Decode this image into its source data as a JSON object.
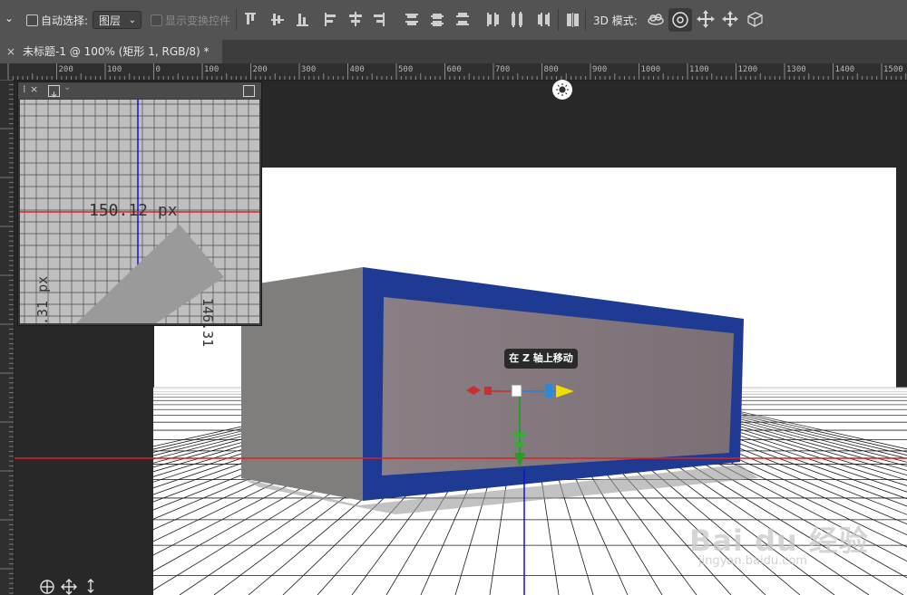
{
  "options_bar": {
    "auto_select_label": "自动选择:",
    "auto_select_value": "图层",
    "show_transform_label": "显示变换控件",
    "mode_3d_label": "3D 模式:"
  },
  "document_tab": {
    "close_glyph": "×",
    "title": "未标题-1 @ 100% (矩形 1, RGB/8) *"
  },
  "ruler": {
    "labels": [
      "200",
      "100",
      "0",
      "100",
      "200",
      "300",
      "400",
      "500",
      "600",
      "700",
      "800",
      "900",
      "1000",
      "1100",
      "1200",
      "1300",
      "1400",
      "1500"
    ]
  },
  "panel": {
    "width_readout": "150.12 px",
    "height_readout": "146.31",
    "left_readout": ".31 px"
  },
  "tooltip": {
    "text": "在 Z 轴上移动"
  },
  "watermark": {
    "brand": "Bai du 经验",
    "url": "jingyan.baidu.com"
  },
  "colors": {
    "accent_blue": "#1f3a93",
    "guide_red": "#e02020",
    "guide_blue": "#1010e0"
  }
}
